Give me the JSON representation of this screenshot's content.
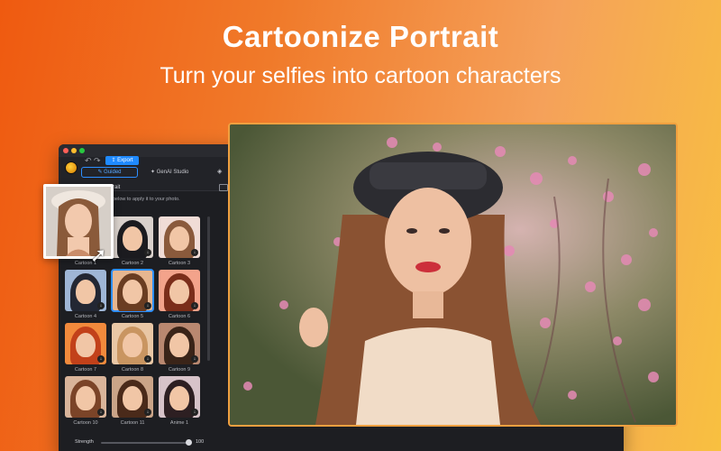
{
  "hero": {
    "title": "Cartoonize Portrait",
    "subtitle": "Turn your selfies into cartoon characters"
  },
  "app": {
    "toolbar": {
      "export_label": "Export",
      "tabs": [
        {
          "label": "Guided",
          "active": true
        },
        {
          "label": "GenAI Studio",
          "active": false
        }
      ]
    },
    "panel": {
      "title": "rait",
      "hint": "below to apply it to your photo."
    },
    "styles": [
      {
        "label": "Cartoon 1",
        "selected": false
      },
      {
        "label": "Cartoon 2",
        "selected": false
      },
      {
        "label": "Cartoon 3",
        "selected": false
      },
      {
        "label": "Cartoon 4",
        "selected": false
      },
      {
        "label": "Cartoon 5",
        "selected": true
      },
      {
        "label": "Cartoon 6",
        "selected": false
      },
      {
        "label": "Cartoon 7",
        "selected": false
      },
      {
        "label": "Cartoon 8",
        "selected": false
      },
      {
        "label": "Cartoon 9",
        "selected": false
      },
      {
        "label": "Cartoon 10",
        "selected": false
      },
      {
        "label": "Cartoon 11",
        "selected": false
      },
      {
        "label": "Anime 1",
        "selected": false
      }
    ],
    "strength": {
      "label": "Strength",
      "value": "100"
    }
  },
  "colors": {
    "accent": "#1f8aff",
    "frame": "#f0a040",
    "app_bg": "#1d1e22"
  },
  "icons": {
    "download": "download-icon",
    "cursor": "cursor-arrow-icon"
  }
}
